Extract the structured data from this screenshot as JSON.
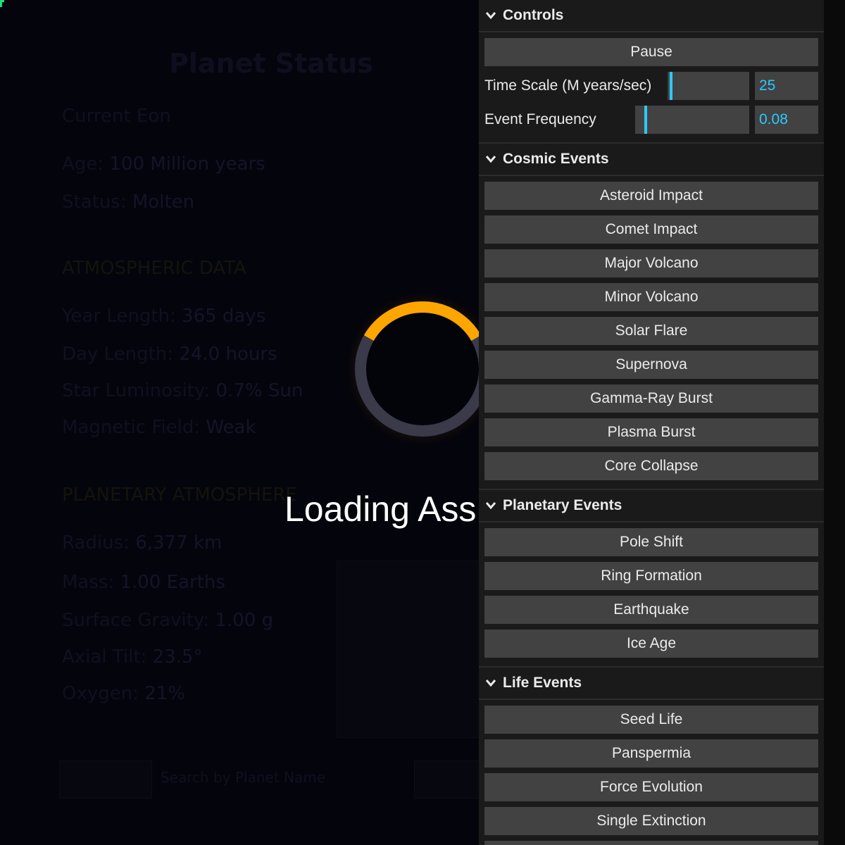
{
  "background": {
    "title": "Planet Status",
    "lines": [
      {
        "label": "Current Eon",
        "value": ""
      },
      {
        "label": "Age:",
        "value": "100 Million years"
      },
      {
        "label": "Status:",
        "value": "Molten"
      },
      {
        "label": "ATMOSPHERIC DATA",
        "value": "",
        "section": true
      },
      {
        "label": "Year Length:",
        "value": "365 days"
      },
      {
        "label": "Day Length:",
        "value": "24.0 hours"
      },
      {
        "label": "Star Luminosity:",
        "value": "0.7% Sun"
      },
      {
        "label": "Magnetic Field:",
        "value": "Weak"
      },
      {
        "label": "PLANETARY ATMOSPHERE",
        "value": "",
        "section": true
      },
      {
        "label": "Radius:",
        "value": "6,377 km"
      },
      {
        "label": "Mass:",
        "value": "1.00 Earths"
      },
      {
        "label": "Surface Gravity:",
        "value": "1.00 g"
      },
      {
        "label": "Axial Tilt:",
        "value": "23.5°"
      },
      {
        "label": "Oxygen:",
        "value": "21%"
      }
    ],
    "search_text": "Search by Planet Name"
  },
  "loading": {
    "text": "Loading Ass",
    "arc_color": "#ffa500",
    "track_color": "#3a3a4a"
  },
  "panel": {
    "controls": {
      "title": "Controls",
      "pause_label": "Pause",
      "time_scale": {
        "label": "Time Scale (M years/sec)",
        "value": "25",
        "fraction": 0.03
      },
      "event_frequency": {
        "label": "Event Frequency",
        "value": "0.08",
        "fraction": 0.08
      }
    },
    "cosmic_events": {
      "title": "Cosmic Events",
      "buttons": [
        "Asteroid Impact",
        "Comet Impact",
        "Major Volcano",
        "Minor Volcano",
        "Solar Flare",
        "Supernova",
        "Gamma-Ray Burst",
        "Plasma Burst",
        "Core Collapse"
      ]
    },
    "planetary_events": {
      "title": "Planetary Events",
      "buttons": [
        "Pole Shift",
        "Ring Formation",
        "Earthquake",
        "Ice Age"
      ]
    },
    "life_events": {
      "title": "Life Events",
      "buttons": [
        "Seed Life",
        "Panspermia",
        "Force Evolution",
        "Single Extinction",
        ""
      ]
    }
  },
  "colors": {
    "panel_bg": "#1a1a1a",
    "button_bg": "#424242",
    "accent": "#2cc9ff",
    "text": "#ebebeb"
  }
}
